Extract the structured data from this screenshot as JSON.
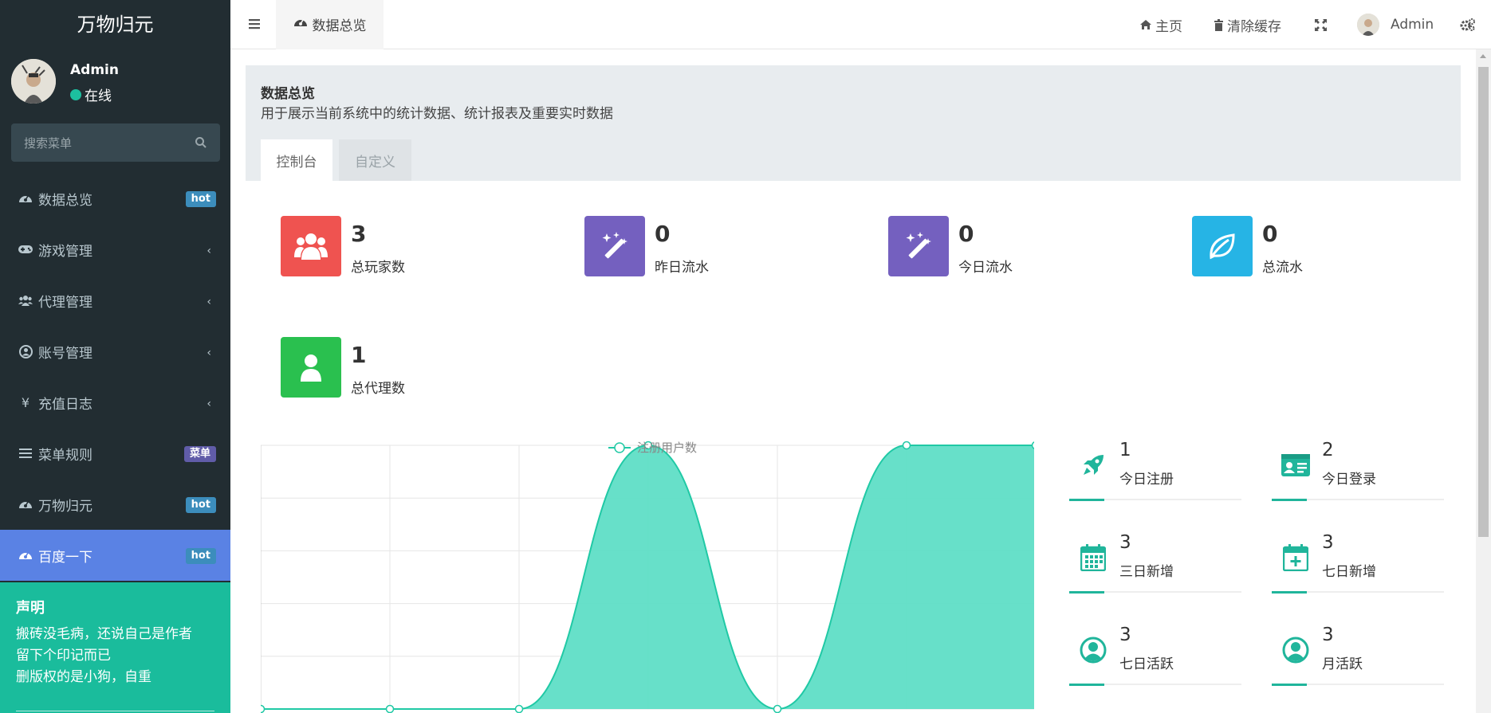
{
  "sidebar": {
    "logo": "万物归元",
    "user": {
      "name": "Admin",
      "status": "在线"
    },
    "search_placeholder": "搜索菜单",
    "items": [
      {
        "label": "数据总览",
        "badge": "hot",
        "badge_color": "#3c8dbc"
      },
      {
        "label": "游戏管理"
      },
      {
        "label": "代理管理"
      },
      {
        "label": "账号管理"
      },
      {
        "label": "充值日志",
        "icon_text": "¥"
      },
      {
        "label": "菜单规则",
        "badge": "菜单",
        "badge_color": "#605ca8"
      },
      {
        "label": "万物归元",
        "badge": "hot",
        "badge_color": "#3c8dbc"
      },
      {
        "label": "百度一下",
        "badge": "hot",
        "badge_color": "#3c8dbc"
      }
    ],
    "notice": {
      "title": "声明",
      "lines": [
        "搬砖没毛病，还说自己是作者",
        "留下个印记而已",
        "删版权的是小狗，自重"
      ]
    }
  },
  "header": {
    "tab_label": "数据总览",
    "home": "主页",
    "clear_cache": "清除缓存",
    "user": "Admin"
  },
  "page": {
    "title": "数据总览",
    "subtitle": "用于展示当前系统中的统计数据、统计报表及重要实时数据",
    "tabs": [
      "控制台",
      "自定义"
    ]
  },
  "stats": [
    {
      "value": "3",
      "label": "总玩家数",
      "color": "#ef5350",
      "icon": "users-icon"
    },
    {
      "value": "0",
      "label": "昨日流水",
      "color": "#7460bf",
      "icon": "magic-icon"
    },
    {
      "value": "0",
      "label": "今日流水",
      "color": "#7460bf",
      "icon": "magic-icon"
    },
    {
      "value": "0",
      "label": "总流水",
      "color": "#26b4e5",
      "icon": "leaf-icon"
    },
    {
      "value": "1",
      "label": "总代理数",
      "color": "#2ac04f",
      "icon": "user-icon"
    }
  ],
  "mini_stats": [
    {
      "value": "1",
      "label": "今日注册",
      "icon": "rocket-icon"
    },
    {
      "value": "2",
      "label": "今日登录",
      "icon": "id-card-icon"
    },
    {
      "value": "3",
      "label": "三日新增",
      "icon": "calendar-icon"
    },
    {
      "value": "3",
      "label": "七日新增",
      "icon": "calendar-plus-icon"
    },
    {
      "value": "3",
      "label": "七日活跃",
      "icon": "user-circle-icon"
    },
    {
      "value": "3",
      "label": "月活跃",
      "icon": "user-circle-icon"
    }
  ],
  "chart_data": {
    "type": "area",
    "legend": "注册用户数",
    "legend_position": "top-center",
    "x": [
      1,
      2,
      3,
      4,
      5,
      6,
      7
    ],
    "values": [
      0,
      0,
      0,
      1,
      0,
      1,
      1
    ],
    "ylim": [
      0,
      1
    ],
    "grid": true,
    "color": "#20c9a5"
  }
}
